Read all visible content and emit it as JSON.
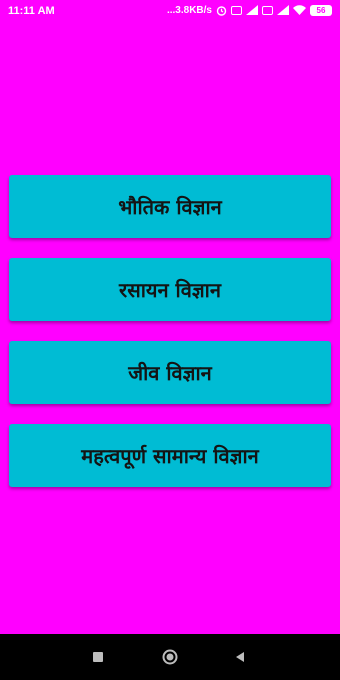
{
  "status_bar": {
    "time": "11:11 AM",
    "network_speed": "...3.8KB/s",
    "battery": "56"
  },
  "menu": {
    "items": [
      {
        "label": "भौतिक विज्ञान"
      },
      {
        "label": "रसायन विज्ञान"
      },
      {
        "label": "जीव विज्ञान"
      },
      {
        "label": "महत्वपूर्ण सामान्य विज्ञान"
      }
    ]
  },
  "nav_bar": {
    "buttons": [
      "recents",
      "home",
      "back"
    ]
  },
  "colors": {
    "background": "#ff00ff",
    "button": "#00bcd4",
    "button_text": "#141414",
    "nav_bar": "#000000"
  }
}
